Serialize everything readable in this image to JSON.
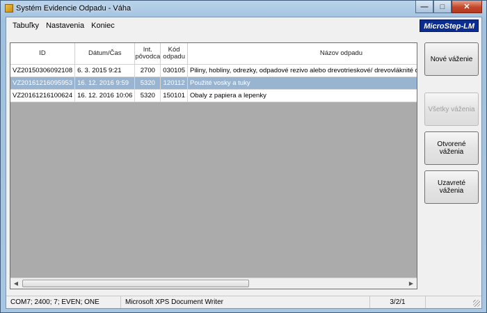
{
  "window": {
    "title": "Systém Evidencie Odpadu - Váha"
  },
  "menu": {
    "items": [
      "Tabuľky",
      "Nastavenia",
      "Koniec"
    ]
  },
  "logo": {
    "text": "MicroStep-LM"
  },
  "table": {
    "columns": [
      "ID",
      "Dátum/Čas",
      "Int. pôvodca",
      "Kód odpadu",
      "Názov odpadu"
    ],
    "rows": [
      {
        "id": "VZ20150306092108",
        "date": "6. 3. 2015 9:21",
        "origin": "2700",
        "code": "030105",
        "name": "Piliny, hobliny, odrezky, odpadové rezivo alebo drevotrieskové/ drevovláknité dosky, dyhy iné ako uvede"
      },
      {
        "id": "VZ20161216095953",
        "date": "16. 12. 2016 9:59",
        "origin": "5320",
        "code": "120112",
        "name": "Použité vosky a tuky",
        "selected": true
      },
      {
        "id": "VZ20161216100624",
        "date": "16. 12. 2016 10:06",
        "origin": "5320",
        "code": "150101",
        "name": "Obaly z papiera a lepenky"
      }
    ]
  },
  "buttons": {
    "new_weighing": "Nové váženie",
    "all_weighings": "Všetky váženia",
    "open_weighings": "Otvorené váženia",
    "closed_weighings": "Uzavreté váženia"
  },
  "status": {
    "port": "COM7; 2400; 7; EVEN; ONE",
    "printer": "Microsoft XPS Document Writer",
    "version": "3/2/1"
  }
}
